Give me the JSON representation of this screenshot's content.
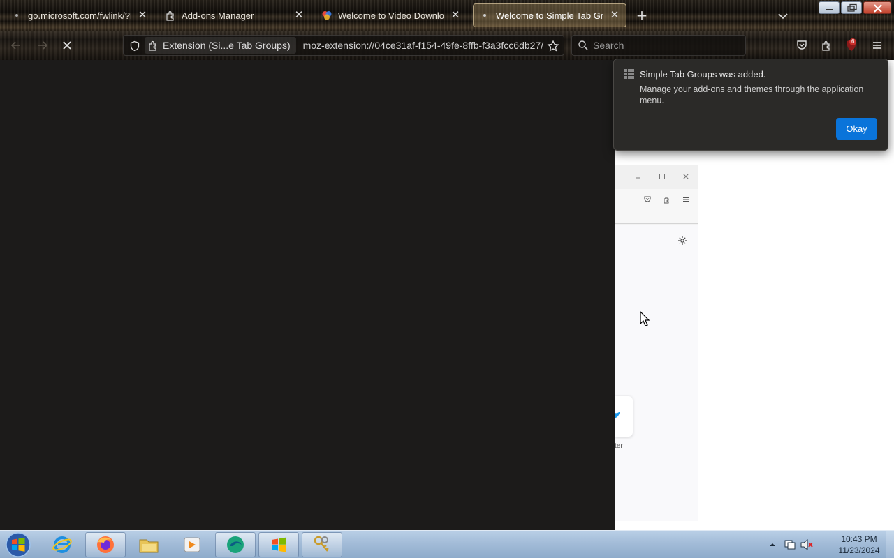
{
  "tabs": [
    {
      "title": "go.microsoft.com/fwlink/?LinkI",
      "favicon": "dot-icon",
      "active": false
    },
    {
      "title": "Add-ons Manager",
      "favicon": "puzzle-icon",
      "active": false
    },
    {
      "title": "Welcome to Video Downloadh",
      "favicon": "video-downloadhelper-icon",
      "active": false
    },
    {
      "title": "Welcome to Simple Tab Groups",
      "favicon": "dot-icon",
      "active": true
    }
  ],
  "navbar": {
    "identity_label": "Extension (Si...e Tab Groups)",
    "url": "moz-extension://04ce31af-f154-49fe-8ffb-f3a3fcc6db27/",
    "search_placeholder": "Search",
    "badge_count": "6"
  },
  "popup": {
    "title": "Simple Tab Groups was added.",
    "body": "Manage your add-ons and themes through the application menu.",
    "button_label": "Okay"
  },
  "inner_window": {
    "caption": "ter"
  },
  "taskbar": {
    "time": "10:43 PM",
    "date": "11/23/2024",
    "apps": [
      "internet-explorer-icon",
      "firefox-icon",
      "file-explorer-icon",
      "media-player-icon",
      "browser-app-icon",
      "windows-update-icon",
      "keys-tool-icon"
    ]
  },
  "colors": {
    "accent": "#0a74da",
    "page_dark": "#1c1b1a",
    "popup_bg": "#2b2a28"
  }
}
